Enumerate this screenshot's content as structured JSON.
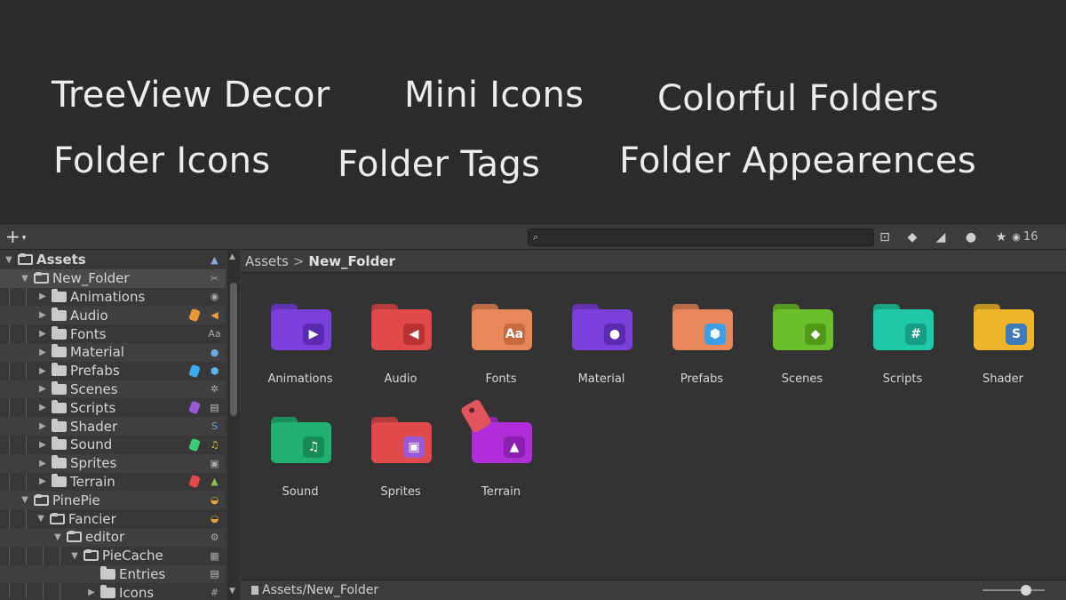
{
  "features": [
    "TreeView Decor",
    "Mini Icons",
    "Colorful Folders",
    "Folder Icons",
    "Folder Tags",
    "Folder Appearences"
  ],
  "toolbar": {
    "add_label": "+",
    "add_caret": "▾",
    "search_icon": "⌕",
    "visible_count": "16",
    "icons": [
      "search-by-type-icon",
      "filter-by-label-icon",
      "tag-icon",
      "warning-icon",
      "star-icon",
      "eye-icon"
    ]
  },
  "tree": [
    {
      "label": "Assets"
    },
    {
      "label": "New_Folder"
    },
    {
      "label": "Animations"
    },
    {
      "label": "Audio"
    },
    {
      "label": "Fonts",
      "mini": "Aa"
    },
    {
      "label": "Material"
    },
    {
      "label": "Prefabs"
    },
    {
      "label": "Scenes"
    },
    {
      "label": "Scripts"
    },
    {
      "label": "Shader"
    },
    {
      "label": "Sound"
    },
    {
      "label": "Sprites"
    },
    {
      "label": "Terrain"
    },
    {
      "label": "PinePie"
    },
    {
      "label": "Fancier"
    },
    {
      "label": "editor"
    },
    {
      "label": "PieCache"
    },
    {
      "label": "Entries"
    },
    {
      "label": "Icons",
      "mini": "#"
    }
  ],
  "breadcrumb": {
    "root": "Assets",
    "separator": ">",
    "current": "New_Folder"
  },
  "folders": [
    {
      "label": "Animations",
      "color": "#7b3fdc",
      "badge_color": "#5a2bb0",
      "badge": "▶"
    },
    {
      "label": "Audio",
      "color": "#e04a4a",
      "badge_color": "#b83232",
      "badge": "◀"
    },
    {
      "label": "Fonts",
      "color": "#e8875a",
      "badge_color": "#c66a3f",
      "badge": "Aa"
    },
    {
      "label": "Material",
      "color": "#7b3fdc",
      "badge_color": "#5a2bb0",
      "badge": "●"
    },
    {
      "label": "Prefabs",
      "color": "#e8875a",
      "badge_color": "#3f9ee8",
      "badge": "⬢"
    },
    {
      "label": "Scenes",
      "color": "#6bbf2a",
      "badge_color": "#4f9a18",
      "badge": "◆"
    },
    {
      "label": "Scripts",
      "color": "#1fc9a8",
      "badge_color": "#169e84",
      "badge": "#"
    },
    {
      "label": "Shader",
      "color": "#f0b62b",
      "badge_color": "#3f7bb8",
      "badge": "S"
    },
    {
      "label": "Sound",
      "color": "#20b070",
      "badge_color": "#178a55",
      "badge": "♫"
    },
    {
      "label": "Sprites",
      "color": "#e04a4a",
      "badge_color": "#9a5ad8",
      "badge": "▣"
    },
    {
      "label": "Terrain",
      "color": "#b02ed8",
      "badge_color": "#8a1fb0",
      "badge": "▲"
    }
  ],
  "status": {
    "path": "Assets/New_Folder"
  }
}
